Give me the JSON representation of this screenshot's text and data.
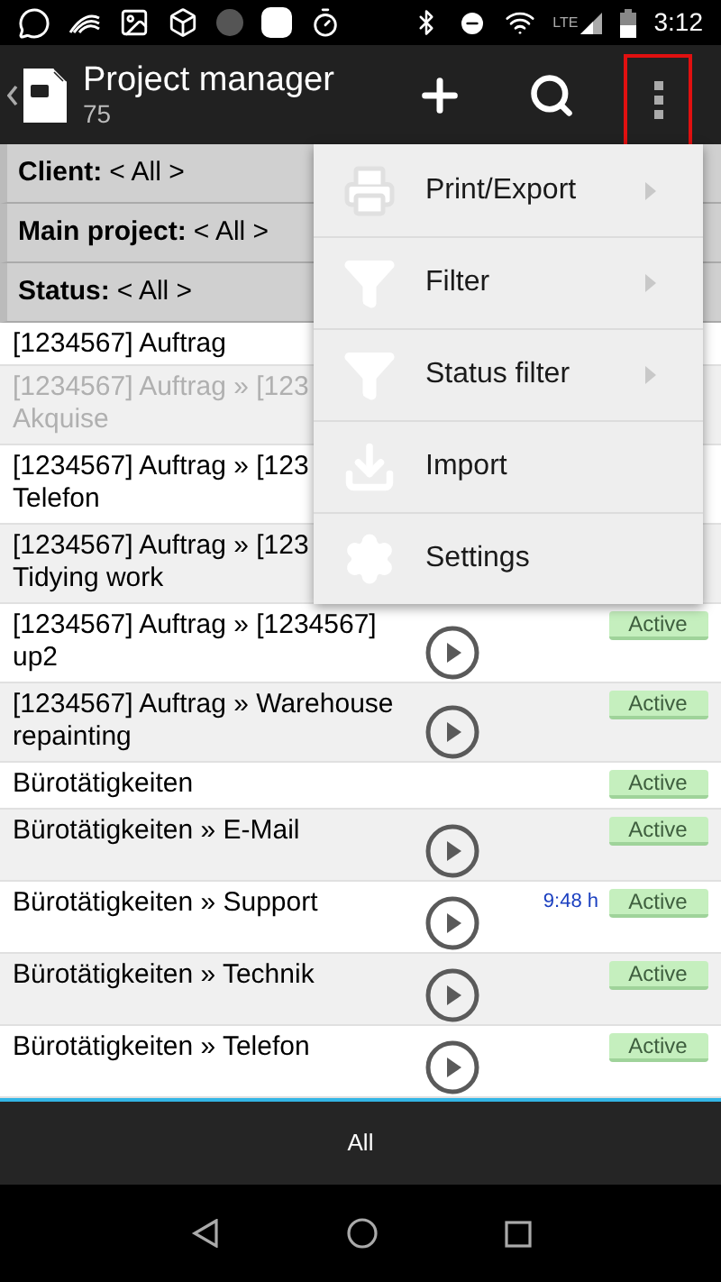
{
  "status_bar": {
    "network": "LTE",
    "time": "3:12"
  },
  "app_bar": {
    "title": "Project manager",
    "count": "75"
  },
  "filters": [
    {
      "label": "Client:",
      "value": "< All >"
    },
    {
      "label": "Main project:",
      "value": "< All >"
    },
    {
      "label": "Status:",
      "value": "< All >"
    }
  ],
  "rows": [
    {
      "lines": [
        "[1234567] Auftrag"
      ],
      "disabled": false,
      "play": false
    },
    {
      "lines": [
        "[1234567] Auftrag » [123",
        "Akquise"
      ],
      "disabled": true,
      "play": false
    },
    {
      "lines": [
        "[1234567] Auftrag » [123",
        "Telefon"
      ],
      "disabled": false,
      "play": false
    },
    {
      "lines": [
        "[1234567] Auftrag » [123",
        "Tidying work"
      ],
      "disabled": false,
      "play": false
    },
    {
      "lines": [
        "[1234567] Auftrag » [1234567]",
        "up2"
      ],
      "disabled": false,
      "play": true,
      "status": "Active"
    },
    {
      "lines": [
        "[1234567] Auftrag » Warehouse",
        "repainting"
      ],
      "disabled": false,
      "play": true,
      "status": "Active"
    },
    {
      "lines": [
        "Bürotätigkeiten"
      ],
      "disabled": false,
      "play": false,
      "status": "Active"
    },
    {
      "lines": [
        "Bürotätigkeiten » E-Mail"
      ],
      "disabled": false,
      "play": true,
      "status": "Active"
    },
    {
      "lines": [
        "Bürotätigkeiten » Support"
      ],
      "disabled": false,
      "play": true,
      "time": "9:48 h",
      "status": "Active"
    },
    {
      "lines": [
        "Bürotätigkeiten » Technik"
      ],
      "disabled": false,
      "play": true,
      "status": "Active"
    },
    {
      "lines": [
        "Bürotätigkeiten » Telefon"
      ],
      "disabled": false,
      "play": true,
      "status": "Active"
    }
  ],
  "menu": {
    "items": [
      {
        "label": "Print/Export",
        "kind": "printer",
        "submenu": true
      },
      {
        "label": "Filter",
        "kind": "funnel",
        "submenu": true
      },
      {
        "label": "Status filter",
        "kind": "funnel",
        "submenu": true
      },
      {
        "label": "Import",
        "kind": "download",
        "submenu": false
      },
      {
        "label": "Settings",
        "kind": "gear",
        "submenu": false
      }
    ]
  },
  "bottom_tab": {
    "label": "All",
    "selected": true
  }
}
